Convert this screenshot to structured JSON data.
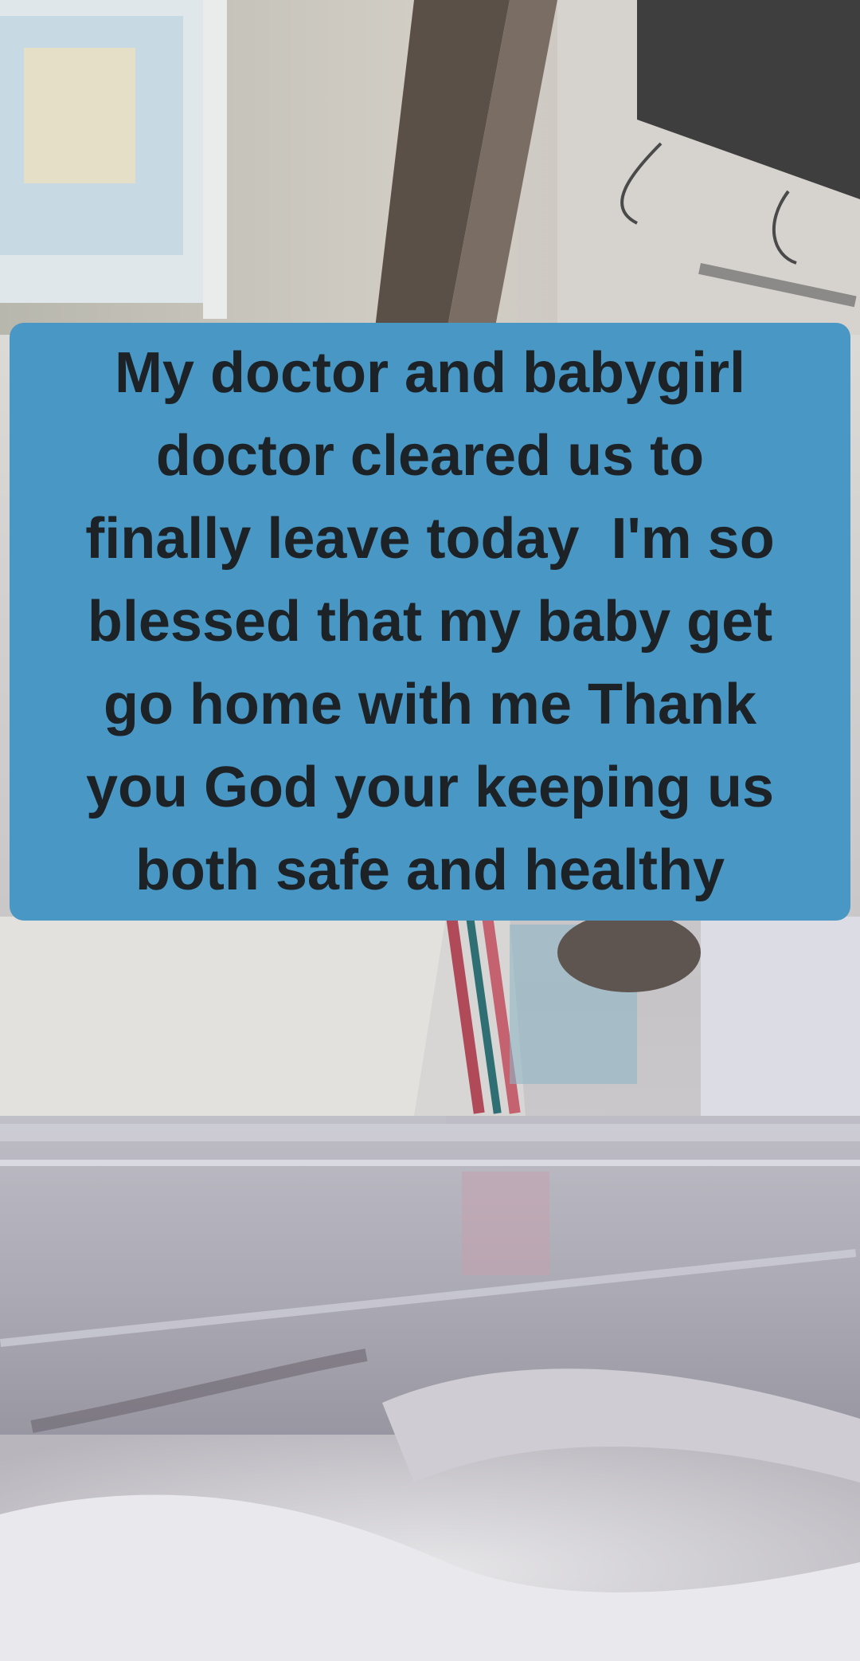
{
  "caption": {
    "lines": [
      "My doctor and babygirl",
      "doctor cleared us to",
      "finally leave today  I'm so",
      "blessed that my baby get",
      "go home with me Thank",
      "you God your keeping us",
      "both safe and healthy"
    ],
    "background_color": "#4897c4",
    "text_color": "#1c2226"
  }
}
